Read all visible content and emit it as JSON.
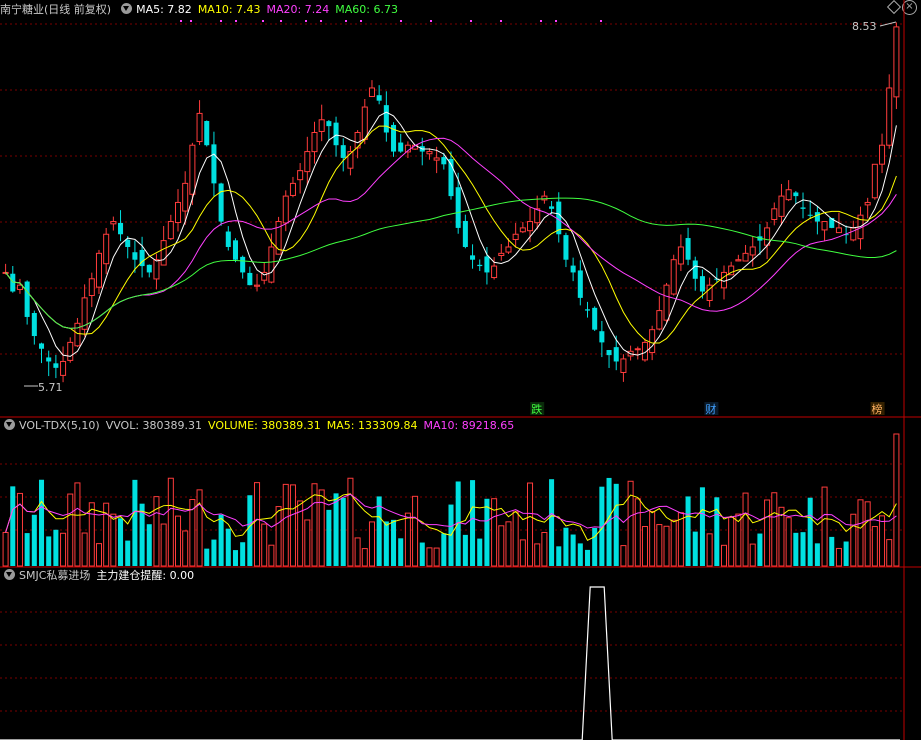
{
  "stock_title": "南宁糖业(日线 前复权)",
  "main_legend": [
    {
      "label": "MA5: 7.82",
      "color": "#ffffff"
    },
    {
      "label": "MA10: 7.43",
      "color": "#ffff00"
    },
    {
      "label": "MA20: 7.24",
      "color": "#ff40ff"
    },
    {
      "label": "MA60: 6.73",
      "color": "#40ff40"
    }
  ],
  "vol_legend": [
    {
      "label": "VOL-TDX(5,10)",
      "color": "#c8c8c8"
    },
    {
      "label": "VVOL: 380389.31",
      "color": "#c8c8c8"
    },
    {
      "label": "VOLUME: 380389.31",
      "color": "#ffff00"
    },
    {
      "label": "MA5: 133309.84",
      "color": "#ffff00"
    },
    {
      "label": "MA10: 89218.65",
      "color": "#ff40ff"
    }
  ],
  "ind_legend": [
    {
      "label": "SMJC私募进场",
      "color": "#c8c8c8"
    },
    {
      "label": "主力建仓提醒: 0.00",
      "color": "#ffffff"
    }
  ],
  "price_annotations": {
    "high": "8.53",
    "low": "5.71"
  },
  "event_markers": [
    {
      "text": "跌",
      "at": 0.596,
      "color": "#40ff40",
      "bg": "#0a2a0a"
    },
    {
      "text": "财",
      "at": 0.79,
      "color": "#40a0ff",
      "bg": "#0a1a2a"
    },
    {
      "text": "榜",
      "at": 0.975,
      "color": "#ffb060",
      "bg": "#332000"
    }
  ],
  "colors": {
    "up": "#ff3c3c",
    "down": "#00e0e0",
    "grid": "#7a0000",
    "axis": "#c00000"
  },
  "chart_data": {
    "type": "candlestick",
    "price_range": [
      5.55,
      8.6
    ],
    "closes": [
      6.6,
      6.45,
      6.5,
      6.25,
      6.1,
      6.0,
      5.9,
      5.85,
      5.9,
      6.05,
      6.2,
      6.4,
      6.55,
      6.75,
      6.9,
      7.0,
      6.9,
      6.8,
      6.7,
      6.65,
      6.6,
      6.7,
      6.85,
      7.0,
      7.15,
      7.3,
      7.6,
      7.85,
      7.6,
      7.3,
      7.0,
      6.8,
      6.7,
      6.6,
      6.5,
      6.5,
      6.6,
      6.8,
      7.0,
      7.2,
      7.3,
      7.4,
      7.55,
      7.7,
      7.8,
      7.75,
      7.6,
      7.5,
      7.55,
      7.7,
      7.9,
      8.05,
      7.95,
      7.7,
      7.55,
      7.55,
      7.6,
      7.6,
      7.55,
      7.55,
      7.5,
      7.45,
      7.2,
      6.95,
      6.8,
      6.7,
      6.65,
      6.6,
      6.65,
      6.75,
      6.8,
      6.9,
      6.95,
      7.0,
      7.1,
      7.2,
      7.1,
      6.9,
      6.7,
      6.6,
      6.4,
      6.3,
      6.15,
      6.05,
      5.95,
      5.9,
      5.92,
      5.98,
      6.0,
      6.05,
      6.15,
      6.3,
      6.5,
      6.7,
      6.8,
      6.7,
      6.55,
      6.45,
      6.5,
      6.55,
      6.6,
      6.65,
      6.7,
      6.75,
      6.8,
      6.85,
      6.95,
      7.1,
      7.2,
      7.25,
      7.2,
      7.1,
      7.05,
      7.0,
      7.0,
      6.95,
      6.95,
      6.9,
      6.95,
      7.05,
      7.15,
      7.45,
      7.6,
      8.05,
      8.53
    ],
    "volume_max": 380389.31
  }
}
